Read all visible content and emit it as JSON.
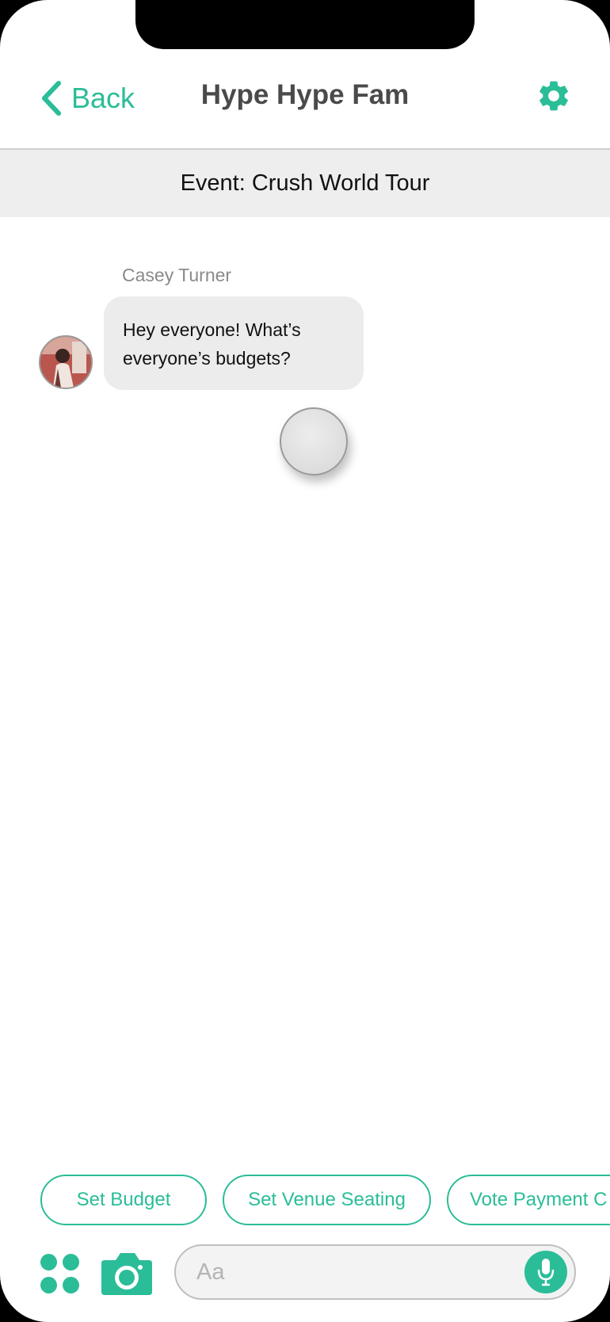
{
  "header": {
    "back_label": "Back",
    "title": "Hype Hype Fam"
  },
  "event": {
    "label": "Event: Crush World Tour"
  },
  "messages": [
    {
      "sender": "Casey Turner",
      "line1": "Hey everyone! What’s",
      "line2": "everyone’s budgets?"
    }
  ],
  "actions": [
    {
      "label": "Set Budget"
    },
    {
      "label": "Set Venue Seating"
    },
    {
      "label": "Vote Payment C"
    }
  ],
  "composer": {
    "placeholder": "Aa"
  },
  "icons": {
    "back": "chevron-left-icon",
    "settings": "gear-icon",
    "apps": "apps-grid-icon",
    "camera": "camera-icon",
    "mic": "microphone-icon"
  },
  "colors": {
    "accent": "#2bbd98",
    "title": "#4a4a4a",
    "event_bar": "#eeeeee",
    "bubble": "#ececec"
  }
}
